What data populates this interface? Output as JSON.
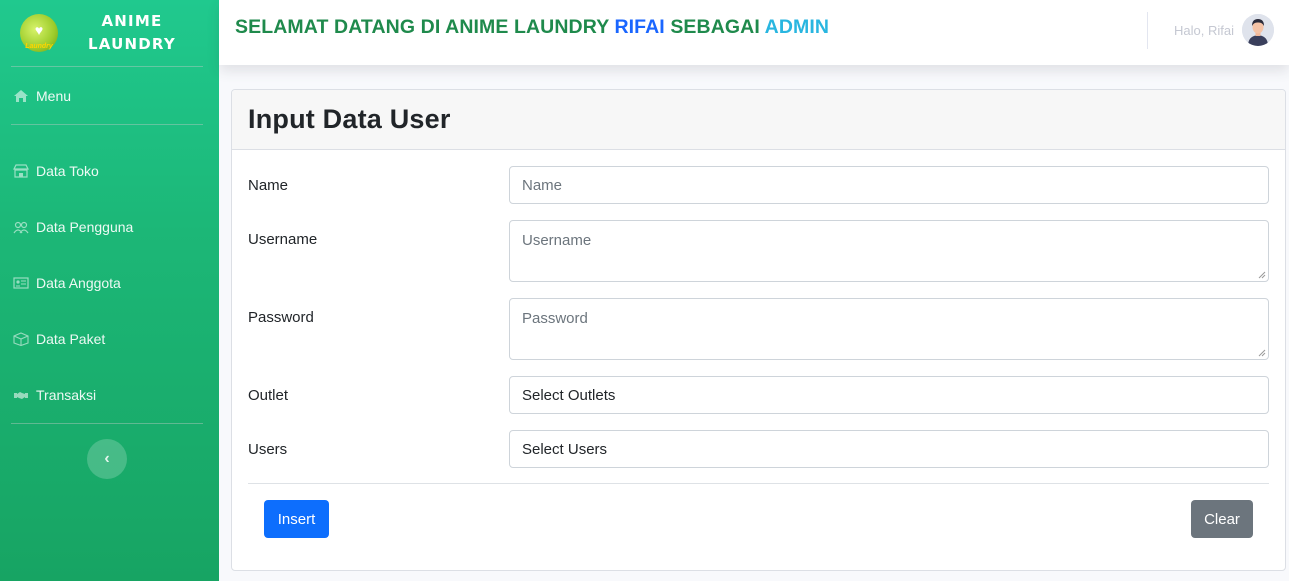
{
  "brand": {
    "line1": "ANIME",
    "line2": "LAUNDRY",
    "logo_text": "Laundry"
  },
  "sidebar": {
    "menu": "Menu",
    "items": [
      {
        "label": "Data Toko",
        "icon": "store-icon"
      },
      {
        "label": "Data Pengguna",
        "icon": "users-icon"
      },
      {
        "label": "Data Anggota",
        "icon": "id-card-icon"
      },
      {
        "label": "Data Paket",
        "icon": "box-icon"
      },
      {
        "label": "Transaksi",
        "icon": "handshake-icon"
      }
    ],
    "toggle_glyph": "‹"
  },
  "topbar": {
    "welcome_part1": "SELAMAT DATANG DI ANIME LAUNDRY ",
    "welcome_name": "RIFAI",
    "welcome_part2": " SEBAGAI ",
    "welcome_role": "ADMIN",
    "hello": "Halo, Rifai"
  },
  "form": {
    "title": "Input Data User",
    "fields": {
      "name": {
        "label": "Name",
        "placeholder": "Name"
      },
      "username": {
        "label": "Username",
        "placeholder": "Username"
      },
      "password": {
        "label": "Password",
        "placeholder": "Password"
      },
      "outlet": {
        "label": "Outlet",
        "value": "Select Outlets"
      },
      "users": {
        "label": "Users",
        "value": "Select Users"
      }
    },
    "insert_label": "Insert",
    "clear_label": "Clear"
  },
  "colors": {
    "sidebar_top": "#20c98e",
    "sidebar_bottom": "#17a463",
    "welcome_green": "#1f8a4c",
    "name_blue": "#1a66ff",
    "role_cyan": "#29b6e0",
    "insert_blue": "#0d6efd",
    "clear_gray": "#6c757d"
  }
}
